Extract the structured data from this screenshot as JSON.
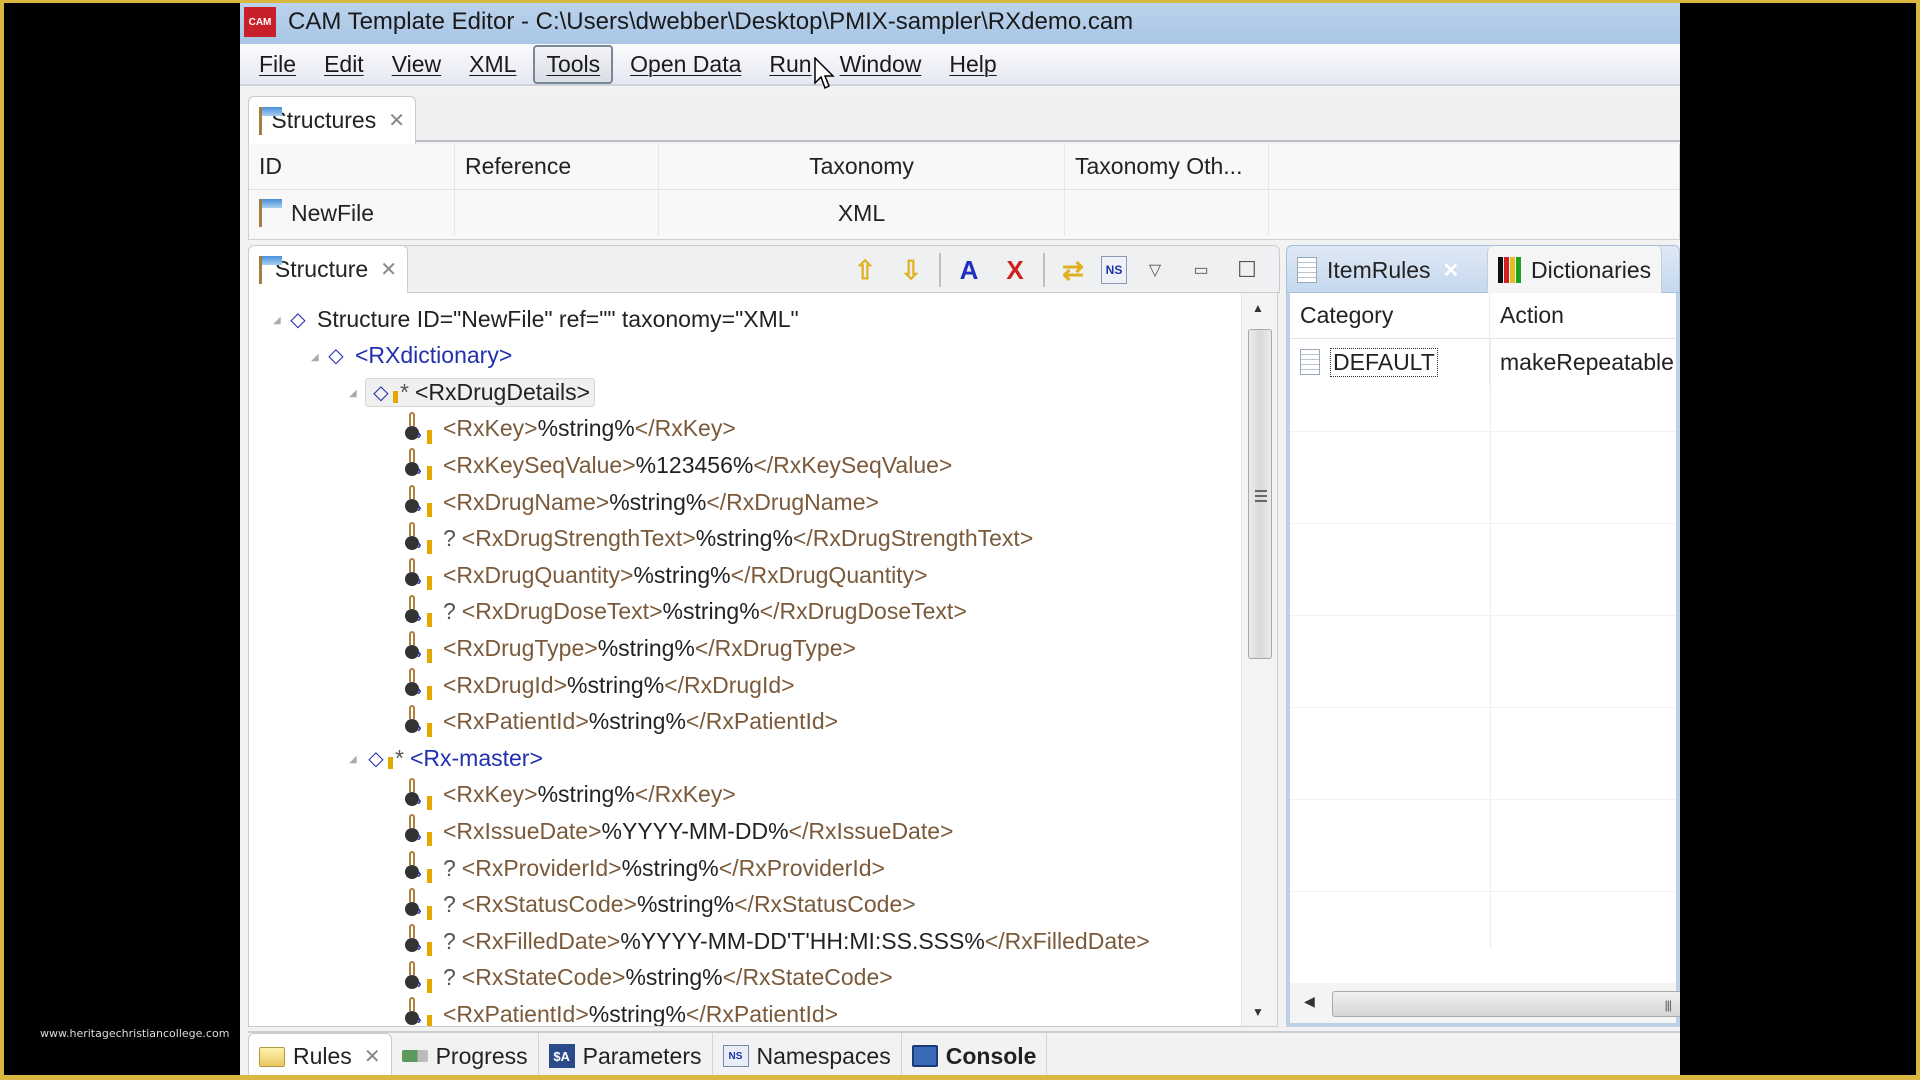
{
  "watermark": "www.heritagechristiancollege.com",
  "window": {
    "logo": "CAM",
    "title": "CAM Template Editor - C:\\Users\\dwebber\\Desktop\\PMIX-sampler\\RXdemo.cam"
  },
  "menu": {
    "items": [
      "File",
      "Edit",
      "View",
      "XML",
      "Tools",
      "Open Data",
      "Run",
      "Window",
      "Help"
    ],
    "active": "Tools"
  },
  "structures_view": {
    "tab_label": "Structures",
    "columns": [
      "ID",
      "Reference",
      "Taxonomy",
      "Taxonomy Oth..."
    ],
    "rows": [
      {
        "id": "NewFile",
        "reference": "",
        "taxonomy": "XML",
        "taxonomy_other": ""
      }
    ]
  },
  "structure_panel": {
    "tab_label": "Structure",
    "toolbar": [
      "move-up",
      "move-down",
      "find-add",
      "find-remove",
      "refresh",
      "namespace",
      "view-menu",
      "minimize",
      "maximize"
    ],
    "tree": [
      {
        "level": 0,
        "kind": "root",
        "text": "Structure ID=\"NewFile\" ref=\"\" taxonomy=\"XML\""
      },
      {
        "level": 1,
        "kind": "group",
        "mark": "",
        "tag": "<RXdictionary>"
      },
      {
        "level": 2,
        "kind": "group-rule",
        "mark": "*",
        "tag": "<RxDrugDetails>",
        "selected": true
      },
      {
        "level": 3,
        "kind": "element",
        "mark": "",
        "open": "<RxKey>",
        "value": "%string%",
        "close": "</RxKey>"
      },
      {
        "level": 3,
        "kind": "element",
        "mark": "",
        "open": "<RxKeySeqValue>",
        "value": "%123456%",
        "close": "</RxKeySeqValue>"
      },
      {
        "level": 3,
        "kind": "element",
        "mark": "",
        "open": "<RxDrugName>",
        "value": "%string%",
        "close": "</RxDrugName>"
      },
      {
        "level": 3,
        "kind": "element",
        "mark": "?",
        "open": "<RxDrugStrengthText>",
        "value": "%string%",
        "close": "</RxDrugStrengthText>"
      },
      {
        "level": 3,
        "kind": "element",
        "mark": "",
        "open": "<RxDrugQuantity>",
        "value": "%string%",
        "close": "</RxDrugQuantity>"
      },
      {
        "level": 3,
        "kind": "element",
        "mark": "?",
        "open": "<RxDrugDoseText>",
        "value": "%string%",
        "close": "</RxDrugDoseText>"
      },
      {
        "level": 3,
        "kind": "element",
        "mark": "",
        "open": "<RxDrugType>",
        "value": "%string%",
        "close": "</RxDrugType>"
      },
      {
        "level": 3,
        "kind": "element",
        "mark": "",
        "open": "<RxDrugId>",
        "value": "%string%",
        "close": "</RxDrugId>"
      },
      {
        "level": 3,
        "kind": "element",
        "mark": "",
        "open": "<RxPatientId>",
        "value": "%string%",
        "close": "</RxPatientId>"
      },
      {
        "level": 2,
        "kind": "group-rule",
        "mark": "*",
        "tag": "<Rx-master>"
      },
      {
        "level": 3,
        "kind": "element",
        "mark": "",
        "open": "<RxKey>",
        "value": "%string%",
        "close": "</RxKey>"
      },
      {
        "level": 3,
        "kind": "element",
        "mark": "",
        "open": "<RxIssueDate>",
        "value": "%YYYY-MM-DD%",
        "close": "</RxIssueDate>"
      },
      {
        "level": 3,
        "kind": "element",
        "mark": "?",
        "open": "<RxProviderId>",
        "value": "%string%",
        "close": "</RxProviderId>"
      },
      {
        "level": 3,
        "kind": "element",
        "mark": "?",
        "open": "<RxStatusCode>",
        "value": "%string%",
        "close": "</RxStatusCode>"
      },
      {
        "level": 3,
        "kind": "element",
        "mark": "?",
        "open": "<RxFilledDate>",
        "value": "%YYYY-MM-DD'T'HH:MI:SS.SSS%",
        "close": "</RxFilledDate>"
      },
      {
        "level": 3,
        "kind": "element",
        "mark": "?",
        "open": "<RxStateCode>",
        "value": "%string%",
        "close": "</RxStateCode>"
      },
      {
        "level": 3,
        "kind": "element",
        "mark": "",
        "open": "<RxPatientId>",
        "value": "%string%",
        "close": "</RxPatientId>"
      }
    ]
  },
  "itemrules_panel": {
    "tabs": [
      "ItemRules",
      "Dictionaries"
    ],
    "active_tab": "ItemRules",
    "columns": [
      "Category",
      "Action"
    ],
    "rows": [
      {
        "category": "DEFAULT",
        "action": "makeRepeatable"
      }
    ]
  },
  "bottom_tabs": [
    {
      "label": "Rules",
      "icon": "folder-icon",
      "active": true,
      "closable": true
    },
    {
      "label": "Progress",
      "icon": "progress-icon"
    },
    {
      "label": "Parameters",
      "icon": "parameters-icon",
      "icon_text": "$A"
    },
    {
      "label": "Namespaces",
      "icon": "namespaces-icon",
      "icon_text": "NS"
    },
    {
      "label": "Console",
      "icon": "console-icon",
      "bold": true
    }
  ],
  "colors": {
    "frame_border": "#d9b840",
    "titlebar": "#a9c6e6",
    "tag_text": "#7a5a3a",
    "group_tag": "#2030b0",
    "required_bar": "#e2a800",
    "logo": "#c8202a"
  }
}
